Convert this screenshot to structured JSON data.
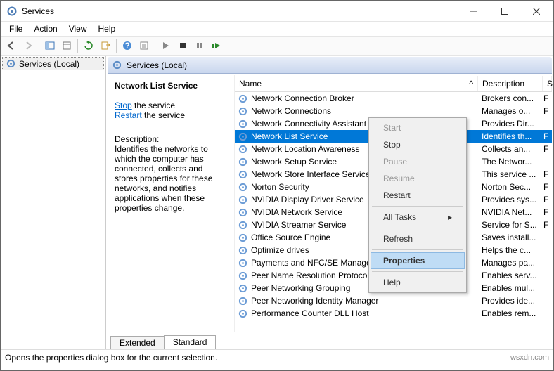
{
  "window": {
    "title": "Services"
  },
  "menubar": [
    "File",
    "Action",
    "View",
    "Help"
  ],
  "tree": {
    "root": "Services (Local)"
  },
  "paneheader": "Services (Local)",
  "detail": {
    "service_name": "Network List Service",
    "stop_link": "Stop",
    "stop_suffix": " the service",
    "restart_link": "Restart",
    "restart_suffix": " the service",
    "desc_label": "Description:",
    "desc_text": "Identifies the networks to which the computer has connected, collects and stores properties for these networks, and notifies applications when these properties change."
  },
  "columns": {
    "name": "Name",
    "desc": "Description",
    "s": "S"
  },
  "rows": [
    {
      "name": "Network Connection Broker",
      "desc": "Brokers con...",
      "s": "F"
    },
    {
      "name": "Network Connections",
      "desc": "Manages o...",
      "s": "F"
    },
    {
      "name": "Network Connectivity Assistant",
      "desc": "Provides Dir...",
      "s": ""
    },
    {
      "name": "Network List Service",
      "desc": "Identifies th...",
      "s": "F",
      "selected": true
    },
    {
      "name": "Network Location Awareness",
      "desc": "Collects an...",
      "s": "F"
    },
    {
      "name": "Network Setup Service",
      "desc": "The Networ...",
      "s": ""
    },
    {
      "name": "Network Store Interface Service",
      "desc": "This service ...",
      "s": "F"
    },
    {
      "name": "Norton Security",
      "desc": "Norton Sec...",
      "s": "F"
    },
    {
      "name": "NVIDIA Display Driver Service",
      "desc": "Provides sys...",
      "s": "F"
    },
    {
      "name": "NVIDIA Network Service",
      "desc": "NVIDIA Net...",
      "s": "F"
    },
    {
      "name": "NVIDIA Streamer Service",
      "desc": "Service for S...",
      "s": "F"
    },
    {
      "name": "Office Source Engine",
      "desc": "Saves install...",
      "s": ""
    },
    {
      "name": "Optimize drives",
      "desc": "Helps the c...",
      "s": ""
    },
    {
      "name": "Payments and NFC/SE Manager",
      "desc": "Manages pa...",
      "s": ""
    },
    {
      "name": "Peer Name Resolution Protocol",
      "desc": "Enables serv...",
      "s": ""
    },
    {
      "name": "Peer Networking Grouping",
      "desc": "Enables mul...",
      "s": ""
    },
    {
      "name": "Peer Networking Identity Manager",
      "desc": "Provides ide...",
      "s": ""
    },
    {
      "name": "Performance Counter DLL Host",
      "desc": "Enables rem...",
      "s": ""
    }
  ],
  "context_menu": {
    "start": "Start",
    "stop": "Stop",
    "pause": "Pause",
    "resume": "Resume",
    "restart": "Restart",
    "all_tasks": "All Tasks",
    "refresh": "Refresh",
    "properties": "Properties",
    "help": "Help"
  },
  "tabs": {
    "extended": "Extended",
    "standard": "Standard"
  },
  "statusbar": {
    "text": "Opens the properties dialog box for the current selection.",
    "watermark": "wsxdn.com"
  }
}
